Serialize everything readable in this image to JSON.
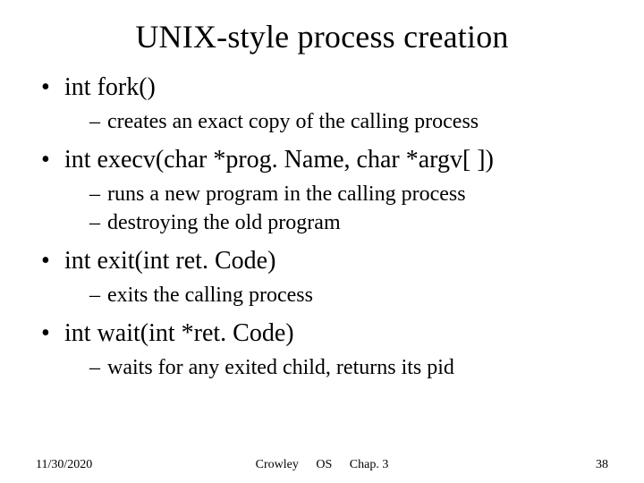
{
  "title": "UNIX-style process creation",
  "bullets": [
    {
      "text": "int fork()",
      "sub": [
        "creates an exact copy of the calling process"
      ]
    },
    {
      "text": "int execv(char *prog. Name, char *argv[ ])",
      "sub": [
        "runs a new program in the calling process",
        "destroying the old program"
      ]
    },
    {
      "text": "int exit(int ret. Code)",
      "sub": [
        "exits the calling process"
      ]
    },
    {
      "text": "int wait(int *ret. Code)",
      "sub": [
        "waits for any exited child, returns its pid"
      ]
    }
  ],
  "footer": {
    "date": "11/30/2020",
    "author": "Crowley",
    "course": "OS",
    "chapter": "Chap. 3",
    "page": "38"
  }
}
